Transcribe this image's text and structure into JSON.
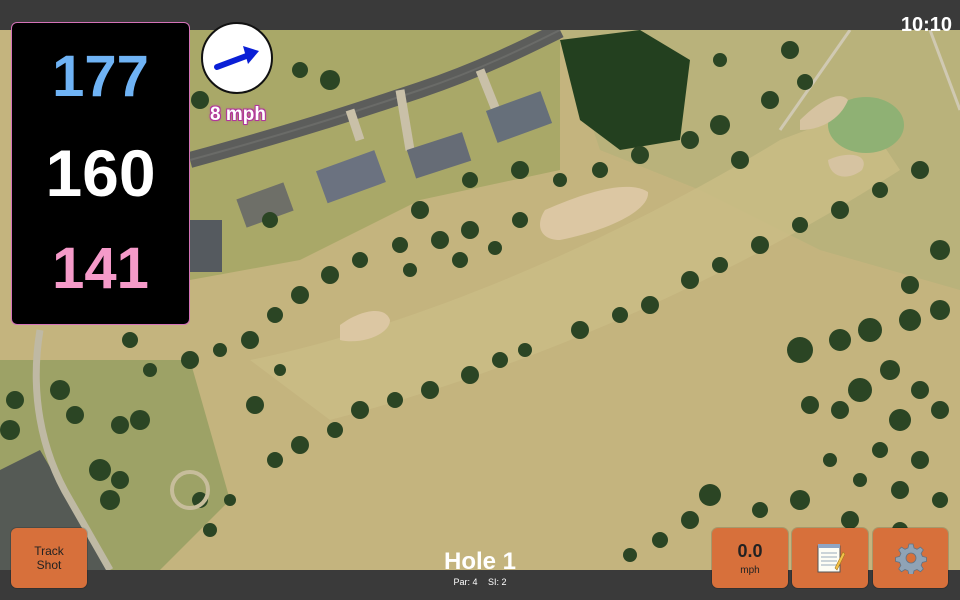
{
  "status": {
    "time": "10:10"
  },
  "distances": {
    "back": "177",
    "middle": "160",
    "front": "141"
  },
  "wind": {
    "speed": "8 mph",
    "direction_icon": "wind-arrow-icon"
  },
  "hole": {
    "title": "Hole 1",
    "par": "Par: 4",
    "si": "SI: 2"
  },
  "buttons": {
    "track_line1": "Track",
    "track_line2": "Shot",
    "speed_value": "0.0",
    "speed_unit": "mph",
    "notes_icon": "notepad-icon",
    "settings_icon": "gear-icon"
  },
  "colors": {
    "back_distance": "#6fb3f5",
    "middle_distance": "#ffffff",
    "front_distance": "#f59ac9",
    "button": "#d7703b",
    "wind_arrow": "#0a1fd6"
  }
}
